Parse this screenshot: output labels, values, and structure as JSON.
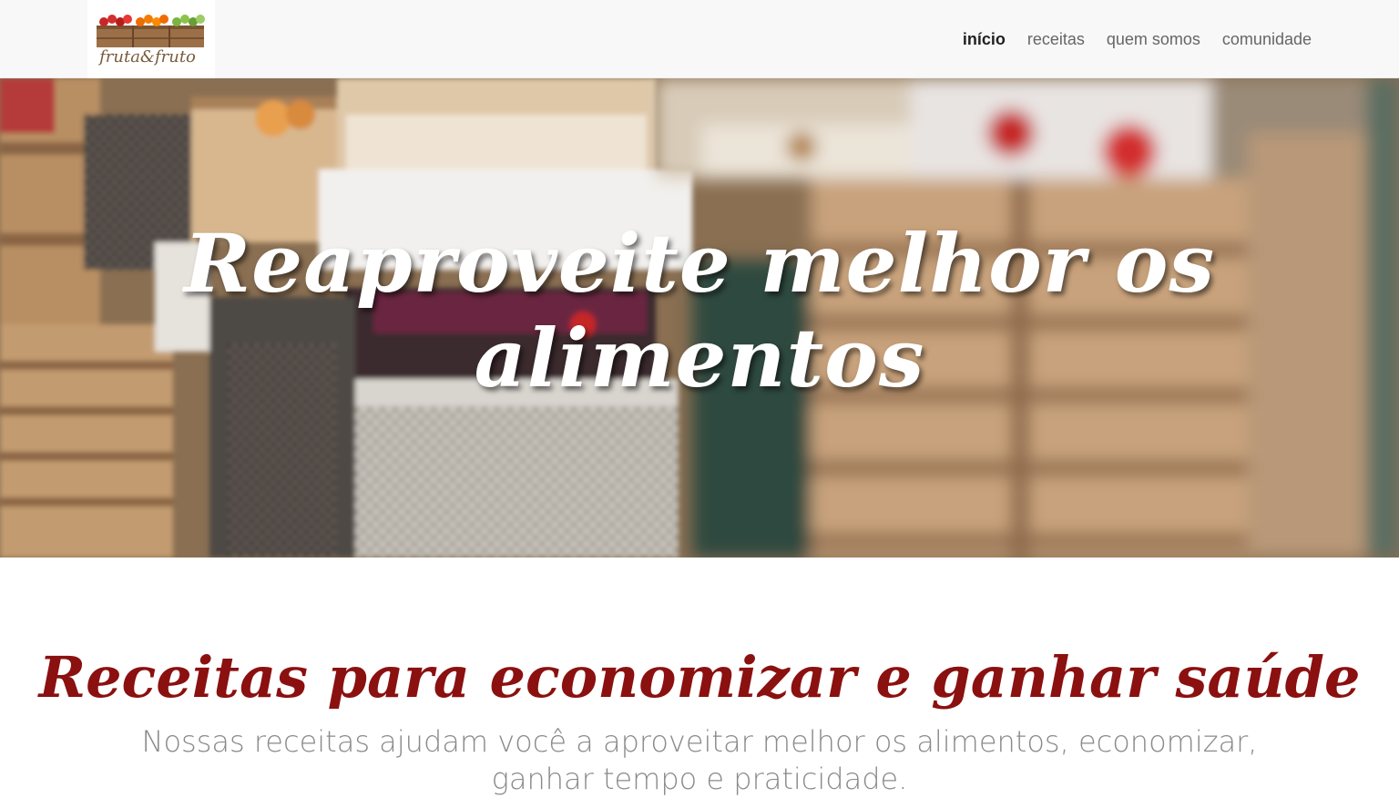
{
  "brand": {
    "logo_text": "fruta&fruto"
  },
  "nav": {
    "items": [
      {
        "label": "início",
        "active": true
      },
      {
        "label": "receitas",
        "active": false
      },
      {
        "label": "quem somos",
        "active": false
      },
      {
        "label": "comunidade",
        "active": false
      }
    ]
  },
  "hero": {
    "title": "Reaproveite melhor os alimentos"
  },
  "main": {
    "title": "Receitas para economizar e ganhar saúde",
    "text": "Nossas receitas ajudam você a aproveitar melhor os alimentos, economizar, ganhar tempo e praticidade."
  },
  "colors": {
    "title_accent": "#8b1010",
    "nav_bg": "#f8f8f8",
    "nav_active": "#222222",
    "nav_link": "#666666"
  }
}
